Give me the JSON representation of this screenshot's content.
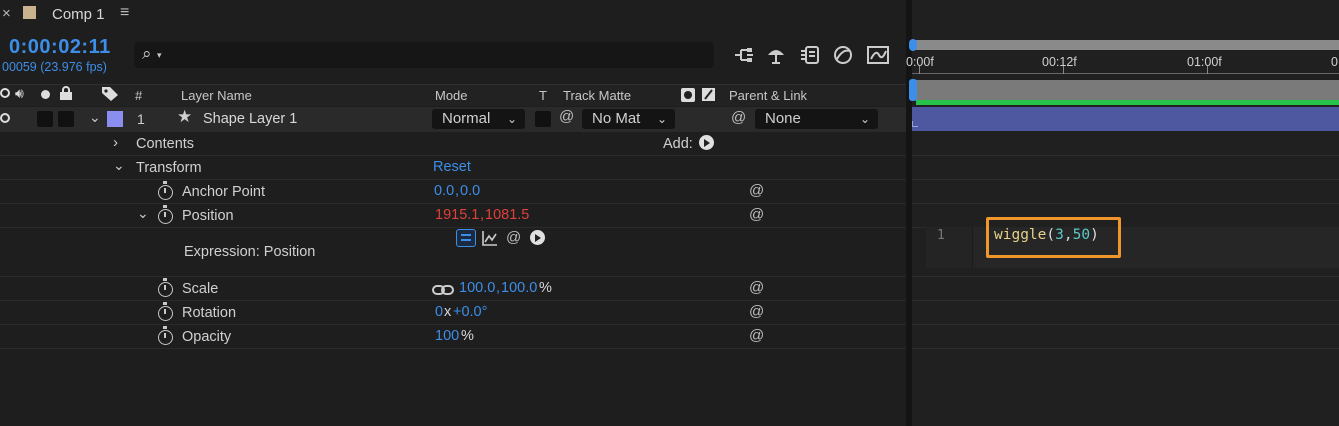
{
  "tab": {
    "close": "×",
    "title": "Comp 1",
    "menu": "≡"
  },
  "time": {
    "timecode": "0:00:02:11",
    "frames": "00059 (23.976 fps)"
  },
  "search": {
    "icon_text": "⌕"
  },
  "headers": {
    "hash": "#",
    "layer_name": "Layer Name",
    "mode": "Mode",
    "t": "T",
    "track_matte": "Track Matte",
    "parent_link": "Parent & Link"
  },
  "ruler": {
    "t0": "0:00f",
    "t1": "00:12f",
    "t2": "01:00f",
    "t3": "0"
  },
  "layer": {
    "number": "1",
    "name": "Shape Layer 1",
    "mode": "Normal",
    "matte": "No Mat",
    "parent": "None",
    "label_color": "#8a8ef0"
  },
  "props": {
    "contents": "Contents",
    "add_label": "Add:",
    "transform": "Transform",
    "reset": "Reset",
    "anchor_label": "Anchor Point",
    "anchor_x": "0.0",
    "anchor_sep": ",",
    "anchor_y": "0.0",
    "position_label": "Position",
    "pos_x": "1915.1",
    "pos_sep": ",",
    "pos_y": "1081.5",
    "expression_label": "Expression: Position",
    "scale_label": "Scale",
    "scale_x": "100.0",
    "scale_sep": ",",
    "scale_y": "100.0",
    "scale_unit": "%",
    "rotation_label": "Rotation",
    "rot_turns": "0",
    "rot_x": "x",
    "rot_deg": "+0.0°",
    "opacity_label": "Opacity",
    "opacity_val": "100",
    "opacity_unit": "%"
  },
  "expression": {
    "line_number": "1",
    "func": "wiggle",
    "open": "(",
    "arg1": "3",
    "comma": ",",
    "arg2": "50",
    "close": ")"
  },
  "colors": {
    "accent_blue": "#3d8ee8",
    "value_red": "#e0403a",
    "highlight_orange": "#f0962b",
    "layer_bar": "#4d58a0",
    "work_area_green": "#27c24a"
  }
}
